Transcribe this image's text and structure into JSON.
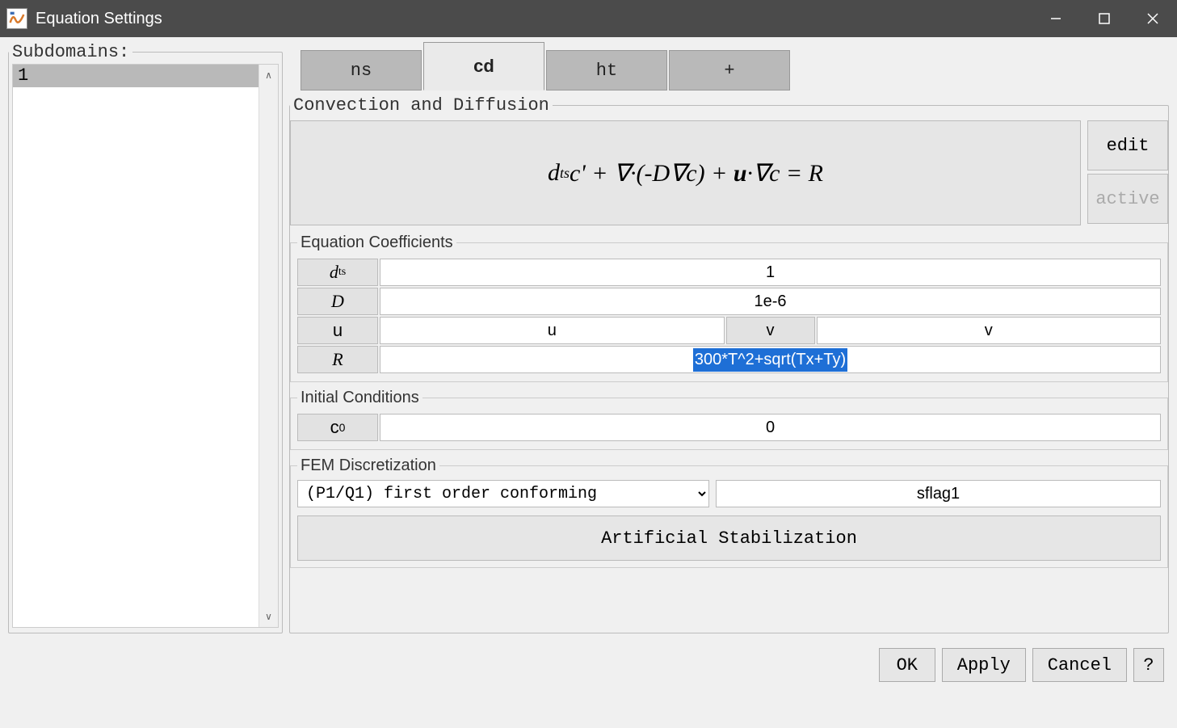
{
  "window": {
    "title": "Equation Settings"
  },
  "subdomains": {
    "legend": "Subdomains:",
    "items": [
      "1"
    ]
  },
  "tabs": [
    {
      "id": "ns",
      "label": "ns",
      "active": false
    },
    {
      "id": "cd",
      "label": "cd",
      "active": true
    },
    {
      "id": "ht",
      "label": "ht",
      "active": false
    },
    {
      "id": "add",
      "label": "+",
      "active": false
    }
  ],
  "cd": {
    "legend": "Convection and Diffusion",
    "equation_text": "dₜₛc' + ∇·(-D∇c) + u·∇c = R",
    "side": {
      "edit": "edit",
      "active": "active"
    },
    "coeffs": {
      "legend": "Equation Coefficients",
      "dts_label": "d",
      "dts_sub": "ts",
      "dts": "1",
      "D_label": "D",
      "D": "1e-6",
      "u_label": "u",
      "u1": "u",
      "mid_v": "v",
      "u2": "v",
      "R_label": "R",
      "R": "300*T^2+sqrt(Tx+Ty)"
    },
    "init": {
      "legend": "Initial Conditions",
      "c0_label": "c",
      "c0_sub": "0",
      "c0": "0"
    },
    "fem": {
      "legend": "FEM Discretization",
      "select": "(P1/Q1) first order conforming",
      "sflag": "sflag1",
      "artstab": "Artificial Stabilization"
    }
  },
  "buttons": {
    "ok": "OK",
    "apply": "Apply",
    "cancel": "Cancel",
    "help": "?"
  }
}
